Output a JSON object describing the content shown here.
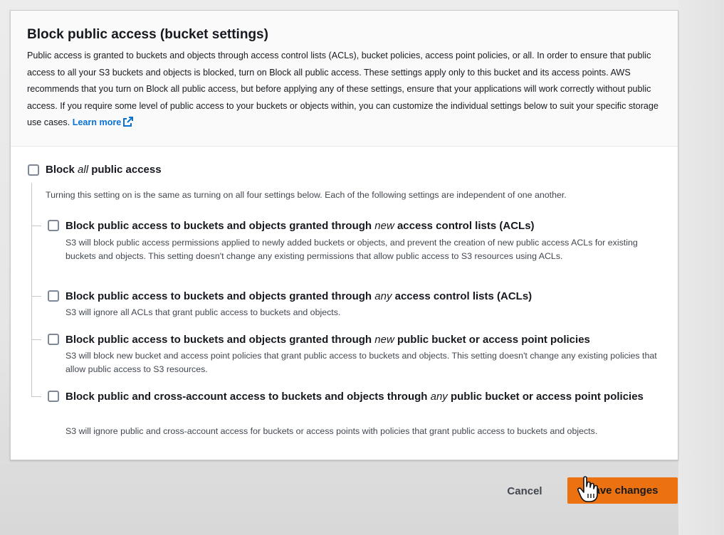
{
  "header": {
    "title": "Block public access (bucket settings)",
    "description": "Public access is granted to buckets and objects through access control lists (ACLs), bucket policies, access point policies, or all. In order to ensure that public access to all your S3 buckets and objects is blocked, turn on Block all public access. These settings apply only to this bucket and its access points. AWS recommends that you turn on Block all public access, but before applying any of these settings, ensure that your applications will work correctly without public access. If you require some level of public access to your buckets or objects within, you can customize the individual settings below to suit your specific storage use cases.",
    "learn_more": "Learn more"
  },
  "block_all": {
    "title_pre": "Block ",
    "title_em": "all",
    "title_post": " public access",
    "description": "Turning this setting on is the same as turning on all four settings below. Each of the following settings are independent of one another.",
    "checked": false
  },
  "options": [
    {
      "title_pre": "Block public access to buckets and objects granted through ",
      "title_em": "new",
      "title_post": " access control lists (ACLs)",
      "description": "S3 will block public access permissions applied to newly added buckets or objects, and prevent the creation of new public access ACLs for existing buckets and objects. This setting doesn't change any existing permissions that allow public access to S3 resources using ACLs.",
      "checked": false
    },
    {
      "title_pre": "Block public access to buckets and objects granted through ",
      "title_em": "any",
      "title_post": " access control lists (ACLs)",
      "description": "S3 will ignore all ACLs that grant public access to buckets and objects.",
      "checked": false
    },
    {
      "title_pre": "Block public access to buckets and objects granted through ",
      "title_em": "new",
      "title_post": " public bucket or access point policies",
      "description": "S3 will block new bucket and access point policies that grant public access to buckets and objects. This setting doesn't change any existing policies that allow public access to S3 resources.",
      "checked": false
    },
    {
      "title_pre": "Block public and cross-account access to buckets and objects through ",
      "title_em": "any",
      "title_post": " public bucket or access point policies",
      "description": "S3 will ignore public and cross-account access for buckets or access points with policies that grant public access to buckets and objects.",
      "checked": false
    }
  ],
  "footer": {
    "cancel_label": "Cancel",
    "save_label": "Save changes"
  },
  "colors": {
    "primary_button": "#ec7211",
    "link": "#0972d3"
  },
  "icons": {
    "external_link": "external-link-icon",
    "cursor": "hand-pointer-cursor"
  }
}
